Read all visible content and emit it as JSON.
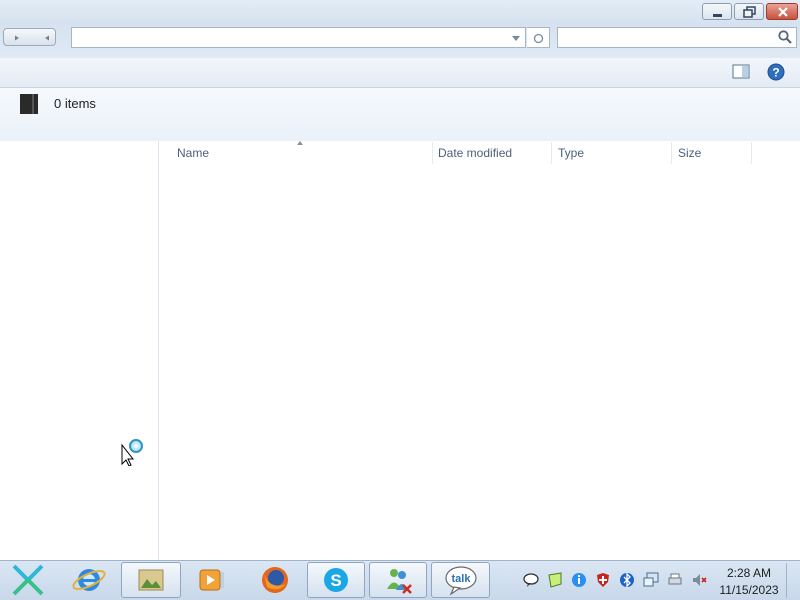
{
  "window": {
    "address_value": "",
    "search_placeholder": "",
    "item_count": "0 items",
    "columns": [
      "Name",
      "Date modified",
      "Type",
      "Size"
    ]
  },
  "icons": {
    "minimize": "minimize-icon",
    "maximize": "restore-icon",
    "close": "close-icon",
    "back": "back-arrow-icon",
    "forward": "forward-arrow-icon",
    "dropdown": "chevron-down-icon",
    "refresh": "refresh-icon",
    "search": "search-icon",
    "preview_pane": "preview-pane-icon",
    "help": "help-icon",
    "library": "library-icon"
  },
  "taskbar": {
    "apps": [
      "start",
      "internet-explorer",
      "explorer",
      "media-player",
      "firefox",
      "skype",
      "messenger",
      "google-talk"
    ],
    "talk_label": "talk",
    "time": "2:28 AM",
    "date": "11/15/2023"
  },
  "colors": {
    "accent": "#3a76c4",
    "taskbar": "#c8d8ea",
    "close_button": "#c85240"
  }
}
